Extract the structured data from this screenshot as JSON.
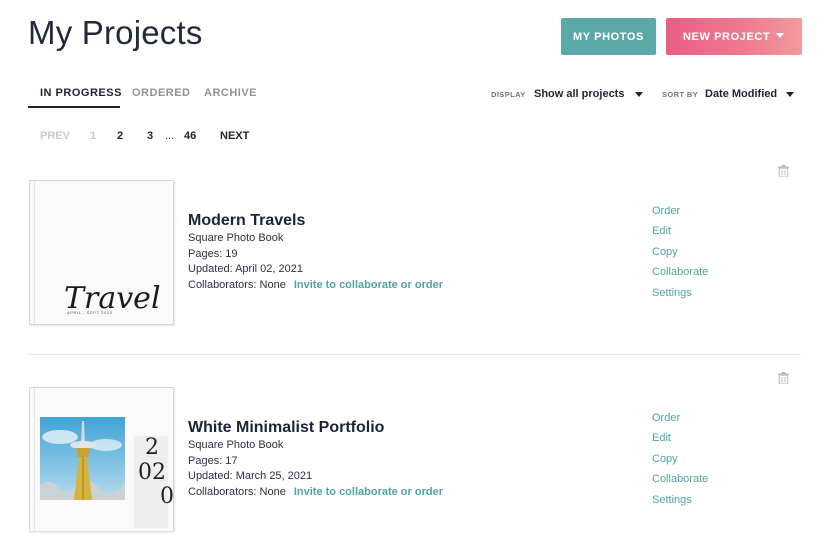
{
  "header": {
    "title": "My Projects",
    "my_photos_label": "MY PHOTOS",
    "new_project_label": "NEW PROJECT"
  },
  "tabs": [
    {
      "label": "IN PROGRESS",
      "active": true
    },
    {
      "label": "ORDERED",
      "active": false
    },
    {
      "label": "ARCHIVE",
      "active": false
    }
  ],
  "filters": {
    "display_label": "DISPLAY",
    "display_value": "Show all projects",
    "sort_label": "SORT BY",
    "sort_value": "Date Modified"
  },
  "pagination": {
    "prev": "PREV",
    "pages": [
      "1",
      "2",
      "3"
    ],
    "ellipsis": "...",
    "last": "46",
    "next": "NEXT",
    "current": "1"
  },
  "projects": [
    {
      "title": "Modern Travels",
      "type": "Square Photo Book",
      "pages": "Pages: 19",
      "updated": "Updated: April 02, 2021",
      "collaborators": "Collaborators: None",
      "invite": "Invite to collaborate or order",
      "cover_text": "Travel",
      "cover_subtext": "APRIL - SEPT 2020",
      "actions": [
        "Order",
        "Edit",
        "Copy",
        "Collaborate",
        "Settings"
      ]
    },
    {
      "title": "White Minimalist Portfolio",
      "type": "Square Photo Book",
      "pages": "Pages: 17",
      "updated": "Updated: March 25, 2021",
      "collaborators": "Collaborators: None",
      "invite": "Invite to collaborate or order",
      "cover_digits": [
        "2",
        "02",
        "0"
      ],
      "actions": [
        "Order",
        "Edit",
        "Copy",
        "Collaborate",
        "Settings"
      ]
    }
  ],
  "colors": {
    "accent_teal": "#5aa9a8",
    "link_teal": "#4fa3a1",
    "pink_gradient_start": "#ea5d86",
    "text_dark": "#1d2433"
  }
}
